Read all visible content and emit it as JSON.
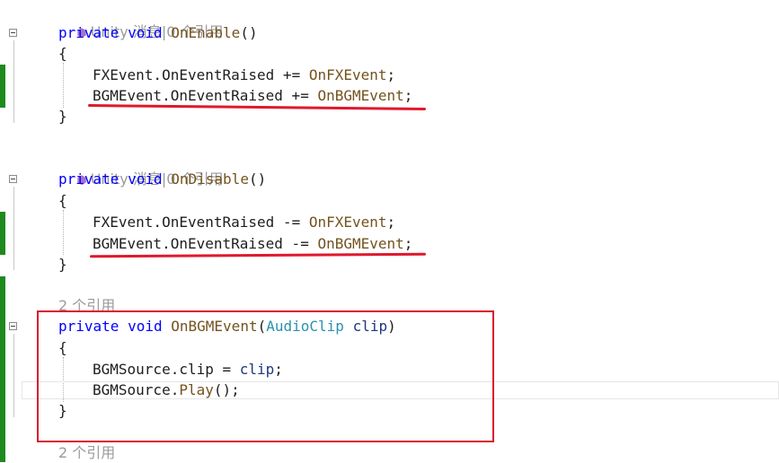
{
  "blocks": {
    "enable": {
      "hint_icon": "unity-cube-icon",
      "hint_text": "Unity 消息|0 个引用",
      "sig_modifier": "private",
      "sig_type": "void",
      "sig_name": "OnEnable",
      "sig_parens": "()",
      "open_brace": "{",
      "line1_target": "FXEvent.OnEventRaised",
      "line1_op": " += ",
      "line1_handler": "OnFXEvent",
      "line1_end": ";",
      "line2_target": "BGMEvent.OnEventRaised",
      "line2_op": " += ",
      "line2_handler": "OnBGMEvent",
      "line2_end": ";",
      "close_brace": "}"
    },
    "disable": {
      "hint_icon": "unity-cube-icon",
      "hint_text": "Unity 消息|0 个引用",
      "sig_modifier": "private",
      "sig_type": "void",
      "sig_name": "OnDisable",
      "sig_parens": "()",
      "open_brace": "{",
      "line1_target": "FXEvent.OnEventRaised",
      "line1_op": " -= ",
      "line1_handler": "OnFXEvent",
      "line1_end": ";",
      "line2_target": "BGMEvent.OnEventRaised",
      "line2_op": " -= ",
      "line2_handler": "OnBGMEvent",
      "line2_end": ";",
      "close_brace": "}"
    },
    "bgm": {
      "hint_text": "2 个引用",
      "sig_modifier": "private",
      "sig_type": "void",
      "sig_name": "OnBGMEvent",
      "sig_open": "(",
      "param_type": "AudioClip",
      "param_name": "clip",
      "sig_close": ")",
      "open_brace": "{",
      "line1_target": "BGMSource.clip",
      "line1_op": " = ",
      "line1_value": "clip",
      "line1_end": ";",
      "line2_target": "BGMSource.",
      "line2_method": "Play",
      "line2_end": "();",
      "close_brace": "}"
    },
    "next": {
      "hint_text": "2 个引用"
    }
  },
  "annotations": {
    "underline_color": "#e0182d",
    "box_color": "#d9182d"
  }
}
